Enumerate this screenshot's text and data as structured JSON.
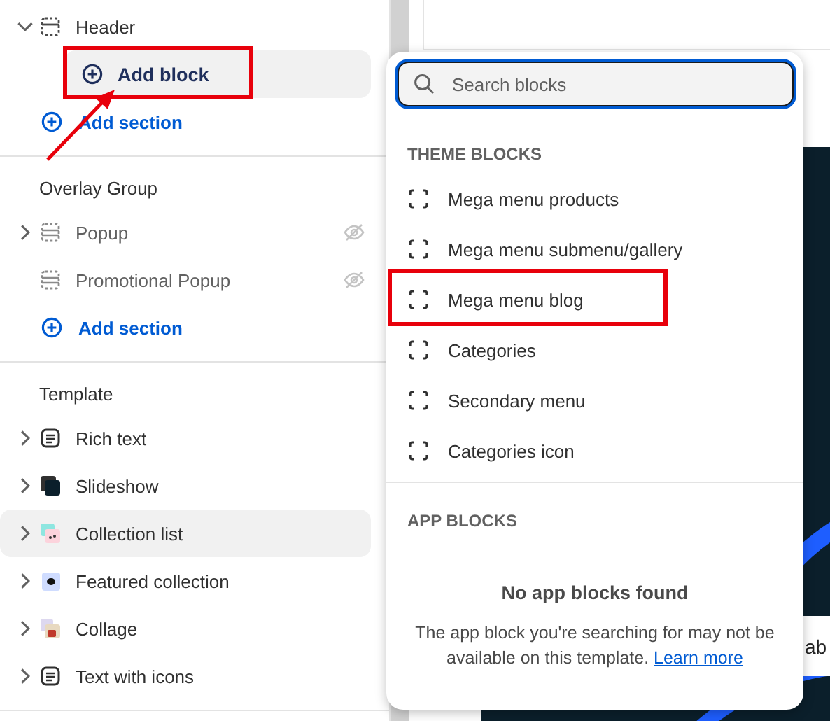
{
  "sidebar": {
    "groups": [
      {
        "items": [
          {
            "label": "Header",
            "kind": "header",
            "expandable": true,
            "expanded": true,
            "hidden": false,
            "hovered": false,
            "children": [
              {
                "label": "Add block",
                "hovered": true,
                "annotated": true
              }
            ]
          }
        ],
        "add_label": "Add section"
      },
      {
        "title": "Overlay Group",
        "items": [
          {
            "label": "Popup",
            "kind": "overlay",
            "expandable": true,
            "expanded": false,
            "hidden": true,
            "hovered": false
          },
          {
            "label": "Promotional Popup",
            "kind": "overlay",
            "expandable": false,
            "expanded": false,
            "hidden": true,
            "hovered": false
          }
        ],
        "add_label": "Add section"
      },
      {
        "title": "Template",
        "items": [
          {
            "label": "Rich text",
            "kind": "text",
            "expandable": true,
            "expanded": false,
            "hidden": false,
            "hovered": false
          },
          {
            "label": "Slideshow",
            "kind": "image",
            "expandable": true,
            "expanded": false,
            "hidden": false,
            "hovered": false
          },
          {
            "label": "Collection list",
            "kind": "image",
            "expandable": true,
            "expanded": false,
            "hidden": false,
            "hovered": true
          },
          {
            "label": "Featured collection",
            "kind": "image",
            "expandable": true,
            "expanded": false,
            "hidden": false,
            "hovered": false
          },
          {
            "label": "Collage",
            "kind": "image",
            "expandable": true,
            "expanded": false,
            "hidden": false,
            "hovered": false
          },
          {
            "label": "Text with icons",
            "kind": "text",
            "expandable": true,
            "expanded": false,
            "hidden": false,
            "hovered": false
          }
        ]
      }
    ]
  },
  "preview": {
    "partial_text": "ab"
  },
  "block_picker": {
    "search": {
      "placeholder": "Search blocks",
      "focused": true
    },
    "theme_blocks": {
      "heading": "THEME BLOCKS",
      "items": [
        {
          "label": "Mega menu products",
          "annotated": false
        },
        {
          "label": "Mega menu submenu/gallery",
          "annotated": false
        },
        {
          "label": "Mega menu blog",
          "annotated": true
        },
        {
          "label": "Categories",
          "annotated": false
        },
        {
          "label": "Secondary menu",
          "annotated": false
        },
        {
          "label": "Categories icon",
          "annotated": false
        }
      ]
    },
    "app_blocks": {
      "heading": "APP BLOCKS",
      "empty_title": "No app blocks found",
      "empty_text": "The app block you're searching for may not be available on this template.",
      "link": "Learn more"
    }
  }
}
